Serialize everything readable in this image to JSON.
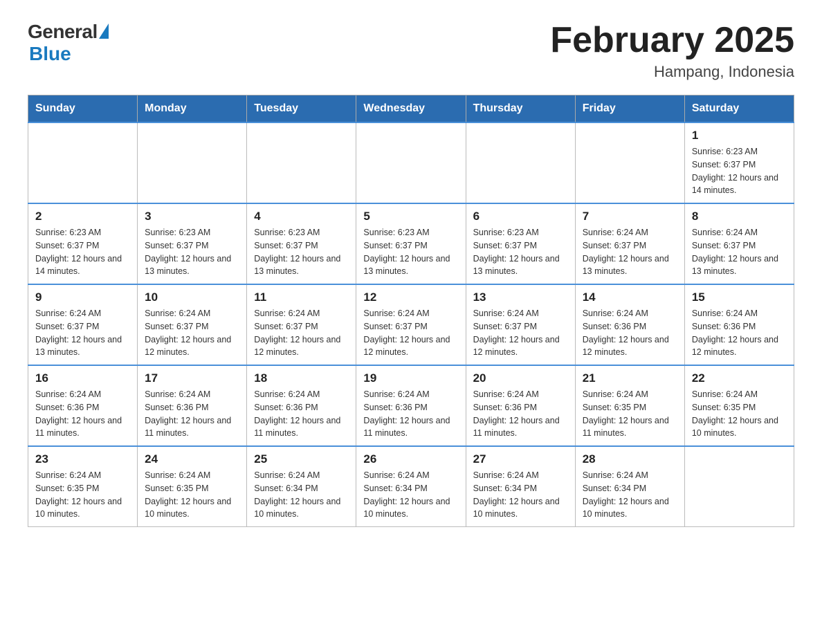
{
  "logo": {
    "general": "General",
    "blue": "Blue"
  },
  "title": {
    "month": "February 2025",
    "location": "Hampang, Indonesia"
  },
  "days_of_week": [
    "Sunday",
    "Monday",
    "Tuesday",
    "Wednesday",
    "Thursday",
    "Friday",
    "Saturday"
  ],
  "weeks": [
    [
      {
        "day": "",
        "sunrise": "",
        "sunset": "",
        "daylight": ""
      },
      {
        "day": "",
        "sunrise": "",
        "sunset": "",
        "daylight": ""
      },
      {
        "day": "",
        "sunrise": "",
        "sunset": "",
        "daylight": ""
      },
      {
        "day": "",
        "sunrise": "",
        "sunset": "",
        "daylight": ""
      },
      {
        "day": "",
        "sunrise": "",
        "sunset": "",
        "daylight": ""
      },
      {
        "day": "",
        "sunrise": "",
        "sunset": "",
        "daylight": ""
      },
      {
        "day": "1",
        "sunrise": "Sunrise: 6:23 AM",
        "sunset": "Sunset: 6:37 PM",
        "daylight": "Daylight: 12 hours and 14 minutes."
      }
    ],
    [
      {
        "day": "2",
        "sunrise": "Sunrise: 6:23 AM",
        "sunset": "Sunset: 6:37 PM",
        "daylight": "Daylight: 12 hours and 14 minutes."
      },
      {
        "day": "3",
        "sunrise": "Sunrise: 6:23 AM",
        "sunset": "Sunset: 6:37 PM",
        "daylight": "Daylight: 12 hours and 13 minutes."
      },
      {
        "day": "4",
        "sunrise": "Sunrise: 6:23 AM",
        "sunset": "Sunset: 6:37 PM",
        "daylight": "Daylight: 12 hours and 13 minutes."
      },
      {
        "day": "5",
        "sunrise": "Sunrise: 6:23 AM",
        "sunset": "Sunset: 6:37 PM",
        "daylight": "Daylight: 12 hours and 13 minutes."
      },
      {
        "day": "6",
        "sunrise": "Sunrise: 6:23 AM",
        "sunset": "Sunset: 6:37 PM",
        "daylight": "Daylight: 12 hours and 13 minutes."
      },
      {
        "day": "7",
        "sunrise": "Sunrise: 6:24 AM",
        "sunset": "Sunset: 6:37 PM",
        "daylight": "Daylight: 12 hours and 13 minutes."
      },
      {
        "day": "8",
        "sunrise": "Sunrise: 6:24 AM",
        "sunset": "Sunset: 6:37 PM",
        "daylight": "Daylight: 12 hours and 13 minutes."
      }
    ],
    [
      {
        "day": "9",
        "sunrise": "Sunrise: 6:24 AM",
        "sunset": "Sunset: 6:37 PM",
        "daylight": "Daylight: 12 hours and 13 minutes."
      },
      {
        "day": "10",
        "sunrise": "Sunrise: 6:24 AM",
        "sunset": "Sunset: 6:37 PM",
        "daylight": "Daylight: 12 hours and 12 minutes."
      },
      {
        "day": "11",
        "sunrise": "Sunrise: 6:24 AM",
        "sunset": "Sunset: 6:37 PM",
        "daylight": "Daylight: 12 hours and 12 minutes."
      },
      {
        "day": "12",
        "sunrise": "Sunrise: 6:24 AM",
        "sunset": "Sunset: 6:37 PM",
        "daylight": "Daylight: 12 hours and 12 minutes."
      },
      {
        "day": "13",
        "sunrise": "Sunrise: 6:24 AM",
        "sunset": "Sunset: 6:37 PM",
        "daylight": "Daylight: 12 hours and 12 minutes."
      },
      {
        "day": "14",
        "sunrise": "Sunrise: 6:24 AM",
        "sunset": "Sunset: 6:36 PM",
        "daylight": "Daylight: 12 hours and 12 minutes."
      },
      {
        "day": "15",
        "sunrise": "Sunrise: 6:24 AM",
        "sunset": "Sunset: 6:36 PM",
        "daylight": "Daylight: 12 hours and 12 minutes."
      }
    ],
    [
      {
        "day": "16",
        "sunrise": "Sunrise: 6:24 AM",
        "sunset": "Sunset: 6:36 PM",
        "daylight": "Daylight: 12 hours and 11 minutes."
      },
      {
        "day": "17",
        "sunrise": "Sunrise: 6:24 AM",
        "sunset": "Sunset: 6:36 PM",
        "daylight": "Daylight: 12 hours and 11 minutes."
      },
      {
        "day": "18",
        "sunrise": "Sunrise: 6:24 AM",
        "sunset": "Sunset: 6:36 PM",
        "daylight": "Daylight: 12 hours and 11 minutes."
      },
      {
        "day": "19",
        "sunrise": "Sunrise: 6:24 AM",
        "sunset": "Sunset: 6:36 PM",
        "daylight": "Daylight: 12 hours and 11 minutes."
      },
      {
        "day": "20",
        "sunrise": "Sunrise: 6:24 AM",
        "sunset": "Sunset: 6:36 PM",
        "daylight": "Daylight: 12 hours and 11 minutes."
      },
      {
        "day": "21",
        "sunrise": "Sunrise: 6:24 AM",
        "sunset": "Sunset: 6:35 PM",
        "daylight": "Daylight: 12 hours and 11 minutes."
      },
      {
        "day": "22",
        "sunrise": "Sunrise: 6:24 AM",
        "sunset": "Sunset: 6:35 PM",
        "daylight": "Daylight: 12 hours and 10 minutes."
      }
    ],
    [
      {
        "day": "23",
        "sunrise": "Sunrise: 6:24 AM",
        "sunset": "Sunset: 6:35 PM",
        "daylight": "Daylight: 12 hours and 10 minutes."
      },
      {
        "day": "24",
        "sunrise": "Sunrise: 6:24 AM",
        "sunset": "Sunset: 6:35 PM",
        "daylight": "Daylight: 12 hours and 10 minutes."
      },
      {
        "day": "25",
        "sunrise": "Sunrise: 6:24 AM",
        "sunset": "Sunset: 6:34 PM",
        "daylight": "Daylight: 12 hours and 10 minutes."
      },
      {
        "day": "26",
        "sunrise": "Sunrise: 6:24 AM",
        "sunset": "Sunset: 6:34 PM",
        "daylight": "Daylight: 12 hours and 10 minutes."
      },
      {
        "day": "27",
        "sunrise": "Sunrise: 6:24 AM",
        "sunset": "Sunset: 6:34 PM",
        "daylight": "Daylight: 12 hours and 10 minutes."
      },
      {
        "day": "28",
        "sunrise": "Sunrise: 6:24 AM",
        "sunset": "Sunset: 6:34 PM",
        "daylight": "Daylight: 12 hours and 10 minutes."
      },
      {
        "day": "",
        "sunrise": "",
        "sunset": "",
        "daylight": ""
      }
    ]
  ]
}
